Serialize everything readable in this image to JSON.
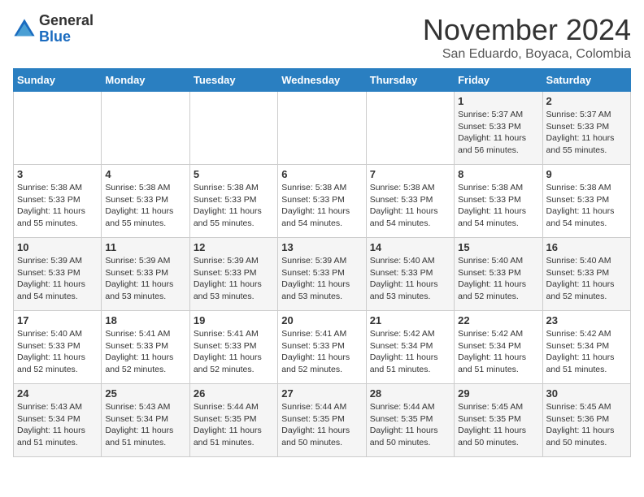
{
  "header": {
    "logo_general": "General",
    "logo_blue": "Blue",
    "month_title": "November 2024",
    "subtitle": "San Eduardo, Boyaca, Colombia"
  },
  "days_of_week": [
    "Sunday",
    "Monday",
    "Tuesday",
    "Wednesday",
    "Thursday",
    "Friday",
    "Saturday"
  ],
  "weeks": [
    [
      {
        "day": "",
        "info": ""
      },
      {
        "day": "",
        "info": ""
      },
      {
        "day": "",
        "info": ""
      },
      {
        "day": "",
        "info": ""
      },
      {
        "day": "",
        "info": ""
      },
      {
        "day": "1",
        "info": "Sunrise: 5:37 AM\nSunset: 5:33 PM\nDaylight: 11 hours\nand 56 minutes."
      },
      {
        "day": "2",
        "info": "Sunrise: 5:37 AM\nSunset: 5:33 PM\nDaylight: 11 hours\nand 55 minutes."
      }
    ],
    [
      {
        "day": "3",
        "info": "Sunrise: 5:38 AM\nSunset: 5:33 PM\nDaylight: 11 hours\nand 55 minutes."
      },
      {
        "day": "4",
        "info": "Sunrise: 5:38 AM\nSunset: 5:33 PM\nDaylight: 11 hours\nand 55 minutes."
      },
      {
        "day": "5",
        "info": "Sunrise: 5:38 AM\nSunset: 5:33 PM\nDaylight: 11 hours\nand 55 minutes."
      },
      {
        "day": "6",
        "info": "Sunrise: 5:38 AM\nSunset: 5:33 PM\nDaylight: 11 hours\nand 54 minutes."
      },
      {
        "day": "7",
        "info": "Sunrise: 5:38 AM\nSunset: 5:33 PM\nDaylight: 11 hours\nand 54 minutes."
      },
      {
        "day": "8",
        "info": "Sunrise: 5:38 AM\nSunset: 5:33 PM\nDaylight: 11 hours\nand 54 minutes."
      },
      {
        "day": "9",
        "info": "Sunrise: 5:38 AM\nSunset: 5:33 PM\nDaylight: 11 hours\nand 54 minutes."
      }
    ],
    [
      {
        "day": "10",
        "info": "Sunrise: 5:39 AM\nSunset: 5:33 PM\nDaylight: 11 hours\nand 54 minutes."
      },
      {
        "day": "11",
        "info": "Sunrise: 5:39 AM\nSunset: 5:33 PM\nDaylight: 11 hours\nand 53 minutes."
      },
      {
        "day": "12",
        "info": "Sunrise: 5:39 AM\nSunset: 5:33 PM\nDaylight: 11 hours\nand 53 minutes."
      },
      {
        "day": "13",
        "info": "Sunrise: 5:39 AM\nSunset: 5:33 PM\nDaylight: 11 hours\nand 53 minutes."
      },
      {
        "day": "14",
        "info": "Sunrise: 5:40 AM\nSunset: 5:33 PM\nDaylight: 11 hours\nand 53 minutes."
      },
      {
        "day": "15",
        "info": "Sunrise: 5:40 AM\nSunset: 5:33 PM\nDaylight: 11 hours\nand 52 minutes."
      },
      {
        "day": "16",
        "info": "Sunrise: 5:40 AM\nSunset: 5:33 PM\nDaylight: 11 hours\nand 52 minutes."
      }
    ],
    [
      {
        "day": "17",
        "info": "Sunrise: 5:40 AM\nSunset: 5:33 PM\nDaylight: 11 hours\nand 52 minutes."
      },
      {
        "day": "18",
        "info": "Sunrise: 5:41 AM\nSunset: 5:33 PM\nDaylight: 11 hours\nand 52 minutes."
      },
      {
        "day": "19",
        "info": "Sunrise: 5:41 AM\nSunset: 5:33 PM\nDaylight: 11 hours\nand 52 minutes."
      },
      {
        "day": "20",
        "info": "Sunrise: 5:41 AM\nSunset: 5:33 PM\nDaylight: 11 hours\nand 52 minutes."
      },
      {
        "day": "21",
        "info": "Sunrise: 5:42 AM\nSunset: 5:34 PM\nDaylight: 11 hours\nand 51 minutes."
      },
      {
        "day": "22",
        "info": "Sunrise: 5:42 AM\nSunset: 5:34 PM\nDaylight: 11 hours\nand 51 minutes."
      },
      {
        "day": "23",
        "info": "Sunrise: 5:42 AM\nSunset: 5:34 PM\nDaylight: 11 hours\nand 51 minutes."
      }
    ],
    [
      {
        "day": "24",
        "info": "Sunrise: 5:43 AM\nSunset: 5:34 PM\nDaylight: 11 hours\nand 51 minutes."
      },
      {
        "day": "25",
        "info": "Sunrise: 5:43 AM\nSunset: 5:34 PM\nDaylight: 11 hours\nand 51 minutes."
      },
      {
        "day": "26",
        "info": "Sunrise: 5:44 AM\nSunset: 5:35 PM\nDaylight: 11 hours\nand 51 minutes."
      },
      {
        "day": "27",
        "info": "Sunrise: 5:44 AM\nSunset: 5:35 PM\nDaylight: 11 hours\nand 50 minutes."
      },
      {
        "day": "28",
        "info": "Sunrise: 5:44 AM\nSunset: 5:35 PM\nDaylight: 11 hours\nand 50 minutes."
      },
      {
        "day": "29",
        "info": "Sunrise: 5:45 AM\nSunset: 5:35 PM\nDaylight: 11 hours\nand 50 minutes."
      },
      {
        "day": "30",
        "info": "Sunrise: 5:45 AM\nSunset: 5:36 PM\nDaylight: 11 hours\nand 50 minutes."
      }
    ]
  ]
}
